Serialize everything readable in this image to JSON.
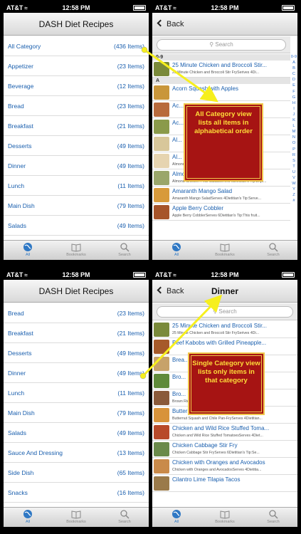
{
  "status": {
    "carrier": "AT&T",
    "time": "12:58 PM"
  },
  "top_left": {
    "title": "DASH Diet Recipes",
    "rows": [
      {
        "label": "All Category",
        "count": "(436 Items)"
      },
      {
        "label": "Appetizer",
        "count": "(23 Items)"
      },
      {
        "label": "Beverage",
        "count": "(12 Items)"
      },
      {
        "label": "Bread",
        "count": "(23 Items)"
      },
      {
        "label": "Breakfast",
        "count": "(21 Items)"
      },
      {
        "label": "Desserts",
        "count": "(49 Items)"
      },
      {
        "label": "Dinner",
        "count": "(49 Items)"
      },
      {
        "label": "Lunch",
        "count": "(11 Items)"
      },
      {
        "label": "Main Dish",
        "count": "(79 Items)"
      },
      {
        "label": "Salads",
        "count": "(49 Items)"
      }
    ]
  },
  "top_right": {
    "back_label": "Back",
    "search_placeholder": "Search",
    "sections": [
      {
        "header": "0-9",
        "items": [
          {
            "title": "25 Minute Chicken and Broccoli Stir...",
            "sub": "25 Minute Chicken and Broccoli Stir FrySerives 4Di..."
          }
        ]
      },
      {
        "header": "A",
        "items": [
          {
            "title": "Acorn Squash with Apples",
            "sub": ""
          },
          {
            "title": "Ac...",
            "sub": ""
          },
          {
            "title": "Ac...",
            "sub": ""
          },
          {
            "title": "Al...",
            "sub": ""
          },
          {
            "title": "Al...",
            "sub": "Almond Rice PuddingServes 6Dietitian's Tip:Try usi..."
          },
          {
            "title": "Almond-Chicken Pear Salad",
            "sub": "Almond-Chicken Pear SaladServes 6Dietitian's Tip:Enjo..."
          },
          {
            "title": "Amaranth Mango Salad",
            "sub": "Amaranth Mango SaladServes 4Dietitian's Tip:Serve..."
          },
          {
            "title": "Apple Berry Cobbler",
            "sub": "Apple Berry CobblerServes 6Dietitian's Tip:This fruit..."
          }
        ]
      }
    ],
    "index": [
      "0-9",
      "A",
      "B",
      "C",
      "D",
      "E",
      "F",
      "G",
      "H",
      "I",
      "J",
      "K",
      "L",
      "M",
      "N",
      "O",
      "P",
      "R",
      "S",
      "T",
      "U",
      "V",
      "W",
      "Y",
      "Z",
      "#"
    ]
  },
  "bottom_left": {
    "title": "DASH Diet Recipes",
    "rows": [
      {
        "label": "Bread",
        "count": "(23 Items)"
      },
      {
        "label": "Breakfast",
        "count": "(21 Items)"
      },
      {
        "label": "Desserts",
        "count": "(49 Items)"
      },
      {
        "label": "Dinner",
        "count": "(49 Items)"
      },
      {
        "label": "Lunch",
        "count": "(11 Items)"
      },
      {
        "label": "Main Dish",
        "count": "(79 Items)"
      },
      {
        "label": "Salads",
        "count": "(49 Items)"
      },
      {
        "label": "Sauce And Dressing",
        "count": "(13 Items)"
      },
      {
        "label": "Side Dish",
        "count": "(65 Items)"
      },
      {
        "label": "Snacks",
        "count": "(16 Items)"
      }
    ]
  },
  "bottom_right": {
    "back_label": "Back",
    "title": "Dinner",
    "search_placeholder": "Search",
    "items": [
      {
        "title": "25 Minute Chicken and Broccoli Stir...",
        "sub": "25 Minute Chicken and Broccoli Stir FrySerives 4Di..."
      },
      {
        "title": "Beef Kabobs with Grilled Pineapple...",
        "sub": ""
      },
      {
        "title": "Brea...",
        "sub": ""
      },
      {
        "title": "Bro...",
        "sub": ""
      },
      {
        "title": "Bro...",
        "sub": "Brown Rice BurgersMakes 12 burgersDietitian's Tip:..."
      },
      {
        "title": "Butternut Squash and Chile Pan-Fry",
        "sub": "Butternut Squash and Chile Pan-FryServes 4Dietitian..."
      },
      {
        "title": "Chicken and Wild Rice Stuffed Toma...",
        "sub": "Chicken and Wild Rice Stuffed TomatoesServes 4Diet..."
      },
      {
        "title": "Chicken Cabbage Stir Fry",
        "sub": "Chicken Cabbage Stir FryServes 6Dietitian's Tip:Se..."
      },
      {
        "title": "Chicken with Oranges and Avocados",
        "sub": "Chicken with Oranges and AvocadosServes 4Dietitia..."
      },
      {
        "title": "Cilantro Lime Tilapia Tacos",
        "sub": ""
      }
    ]
  },
  "tabs": [
    {
      "label": "All"
    },
    {
      "label": "Bookmarks"
    },
    {
      "label": "Search"
    }
  ],
  "callouts": {
    "top": "All Category view lists all items in alphabetical order",
    "bottom": "Single Category view lists only items in that category"
  },
  "colors": {
    "link": "#1a5fae",
    "accent": "#2f78c4",
    "callout_bg": "#a61413",
    "callout_text": "#ffde3a",
    "arrow": "#f6ef1d"
  }
}
